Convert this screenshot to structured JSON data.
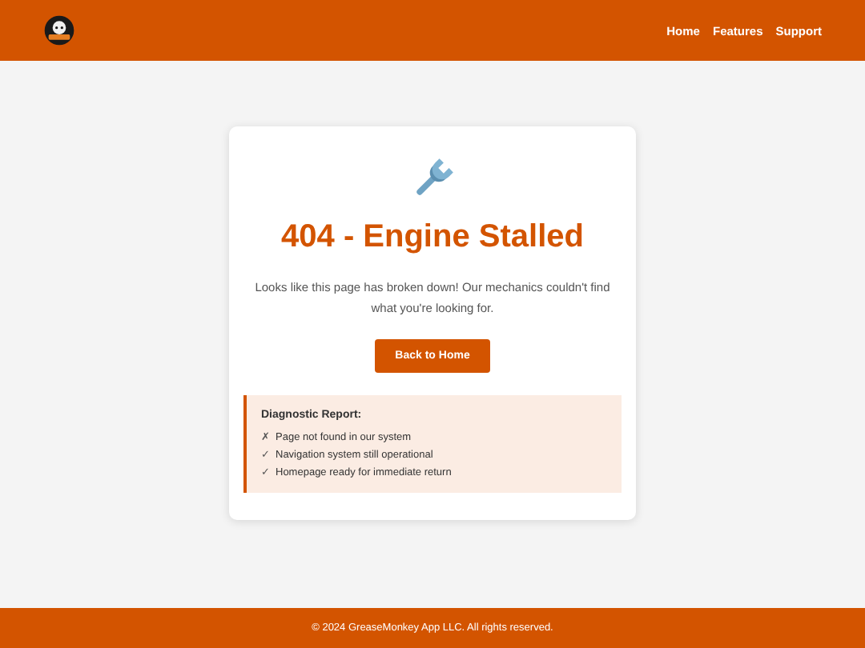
{
  "header": {
    "nav": [
      "Home",
      "Features",
      "Support"
    ]
  },
  "card": {
    "title": "404 - Engine Stalled",
    "message": "Looks like this page has broken down! Our mechanics couldn't find what you're looking for.",
    "button": "Back to Home",
    "report": {
      "title": "Diagnostic Report:",
      "items": [
        {
          "mark": "✗",
          "text": "Page not found in our system"
        },
        {
          "mark": "✓",
          "text": "Navigation system still operational"
        },
        {
          "mark": "✓",
          "text": "Homepage ready for immediate return"
        }
      ]
    }
  },
  "footer": {
    "text": "© 2024 GreaseMonkey App LLC. All rights reserved."
  }
}
